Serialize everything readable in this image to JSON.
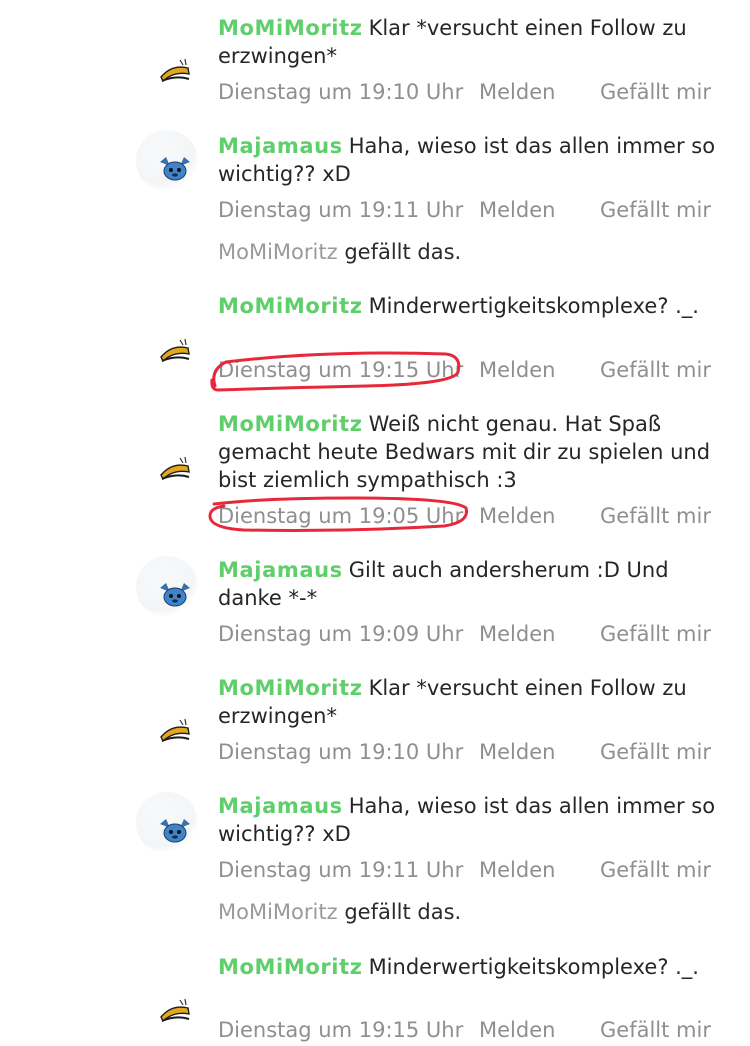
{
  "actions": {
    "report": "Melden",
    "like": "Gefällt mir"
  },
  "likes_suffix": "gefällt das.",
  "comments": [
    {
      "user": "MoMiMoritz",
      "avatar": "banana-avatar-icon",
      "text": "Klar *versucht einen Follow zu erzwingen*",
      "time": "Dienstag um 19:10 Uhr"
    },
    {
      "user": "Majamaus",
      "avatar": "stitch-avatar-icon",
      "text": "Haha, wieso ist das allen immer so wichtig?? xD",
      "time": "Dienstag um 19:11 Uhr",
      "liked_by": "MoMiMoritz"
    },
    {
      "user": "MoMiMoritz",
      "avatar": "banana-avatar-icon",
      "text": "Minderwertigkeitskomplexe? ._.",
      "time": "Dienstag um 19:15 Uhr",
      "highlighted": true
    },
    {
      "user": "MoMiMoritz",
      "avatar": "banana-avatar-icon",
      "text": "Weiß nicht genau. Hat Spaß gemacht heute Bedwars mit dir zu spielen und bist ziemlich sympathisch :3",
      "time": "Dienstag um 19:05 Uhr",
      "highlighted": true
    },
    {
      "user": "Majamaus",
      "avatar": "stitch-avatar-icon",
      "text": "Gilt auch andersherum :D Und danke *-*",
      "time": "Dienstag um 19:09 Uhr"
    },
    {
      "user": "MoMiMoritz",
      "avatar": "banana-avatar-icon",
      "text": "Klar *versucht einen Follow zu erzwingen*",
      "time": "Dienstag um 19:10 Uhr"
    },
    {
      "user": "Majamaus",
      "avatar": "stitch-avatar-icon",
      "text": "Haha, wieso ist das allen immer so wichtig?? xD",
      "time": "Dienstag um 19:11 Uhr",
      "liked_by": "MoMiMoritz"
    },
    {
      "user": "MoMiMoritz",
      "avatar": "banana-avatar-icon",
      "text": "Minderwertigkeitskomplexe? ._.",
      "time": "Dienstag um 19:15 Uhr"
    }
  ],
  "colors": {
    "username": "#5fcf6b",
    "meta": "#8f8f8f",
    "highlight": "#e8283a"
  }
}
